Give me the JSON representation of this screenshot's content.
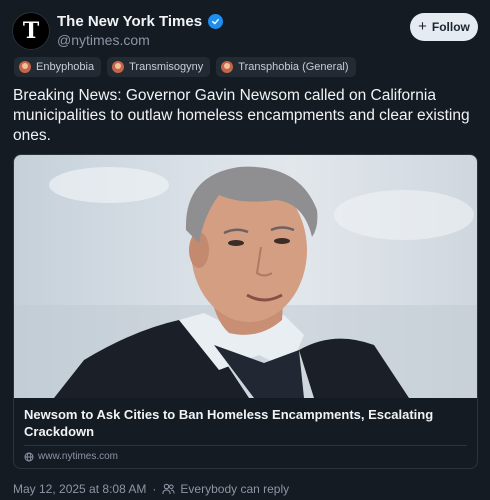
{
  "account": {
    "avatar_glyph": "T",
    "display_name": "The New York Times",
    "handle": "@nytimes.com",
    "verified_icon": "verified-check-icon"
  },
  "follow_button": {
    "icon": "plus-icon",
    "label": "Follow"
  },
  "labels": [
    {
      "icon": "label-avatar-icon",
      "text": "Enbyphobia"
    },
    {
      "icon": "label-avatar-icon",
      "text": "Transmisogyny"
    },
    {
      "icon": "label-avatar-icon",
      "text": "Transphobia (General)"
    }
  ],
  "post": {
    "text": "Breaking News: Governor Gavin Newsom called on California municipalities to outlaw homeless encampments and clear existing ones."
  },
  "link_card": {
    "image": "photo-of-man-in-dark-jacket",
    "title": "Newsom to Ask Cities to Ban Homeless Encampments, Escalating Crackdown",
    "domain_icon": "globe-icon",
    "domain": "www.nytimes.com"
  },
  "meta": {
    "timestamp": "May 12, 2025 at 8:08 AM",
    "separator": "·",
    "reply_icon": "people-icon",
    "reply_setting": "Everybody can reply"
  },
  "colors": {
    "background": "#151b23",
    "follow_bg": "#e6ebf1",
    "verified": "#1f8ef1",
    "muted_text": "#8b96a5"
  }
}
